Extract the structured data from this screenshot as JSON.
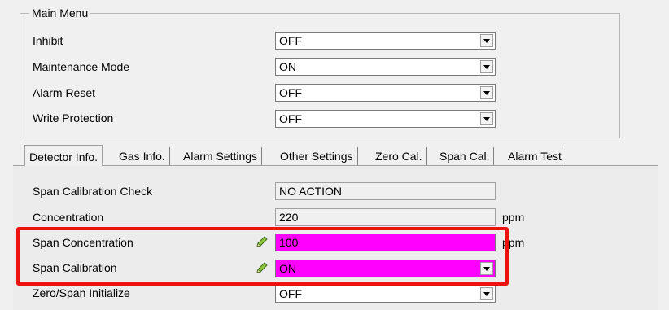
{
  "main_menu": {
    "title": "Main Menu",
    "rows": [
      {
        "label": "Inhibit",
        "value": "OFF"
      },
      {
        "label": "Maintenance Mode",
        "value": "ON"
      },
      {
        "label": "Alarm Reset",
        "value": "OFF"
      },
      {
        "label": "Write Protection",
        "value": "OFF"
      }
    ]
  },
  "tabs": [
    {
      "label": "Detector Info."
    },
    {
      "label": "Gas Info."
    },
    {
      "label": "Alarm Settings"
    },
    {
      "label": "Other Settings"
    },
    {
      "label": "Zero Cal."
    },
    {
      "label": "Span Cal."
    },
    {
      "label": "Alarm Test"
    }
  ],
  "active_tab": "Detector Info.",
  "span_panel": {
    "check": {
      "label": "Span Calibration Check",
      "value": "NO ACTION"
    },
    "concentration": {
      "label": "Concentration",
      "value": "220",
      "unit": "ppm"
    },
    "span_concentration": {
      "label": "Span Concentration",
      "value": "100",
      "unit": "ppm"
    },
    "span_calibration": {
      "label": "Span Calibration",
      "value": "ON"
    },
    "zero_span_init": {
      "label": "Zero/Span Initialize",
      "value": "OFF"
    }
  },
  "colors": {
    "highlight_border": "#ee1111",
    "edited_field": "#ff00ff"
  },
  "icons": {
    "edit": "pencil-icon"
  }
}
